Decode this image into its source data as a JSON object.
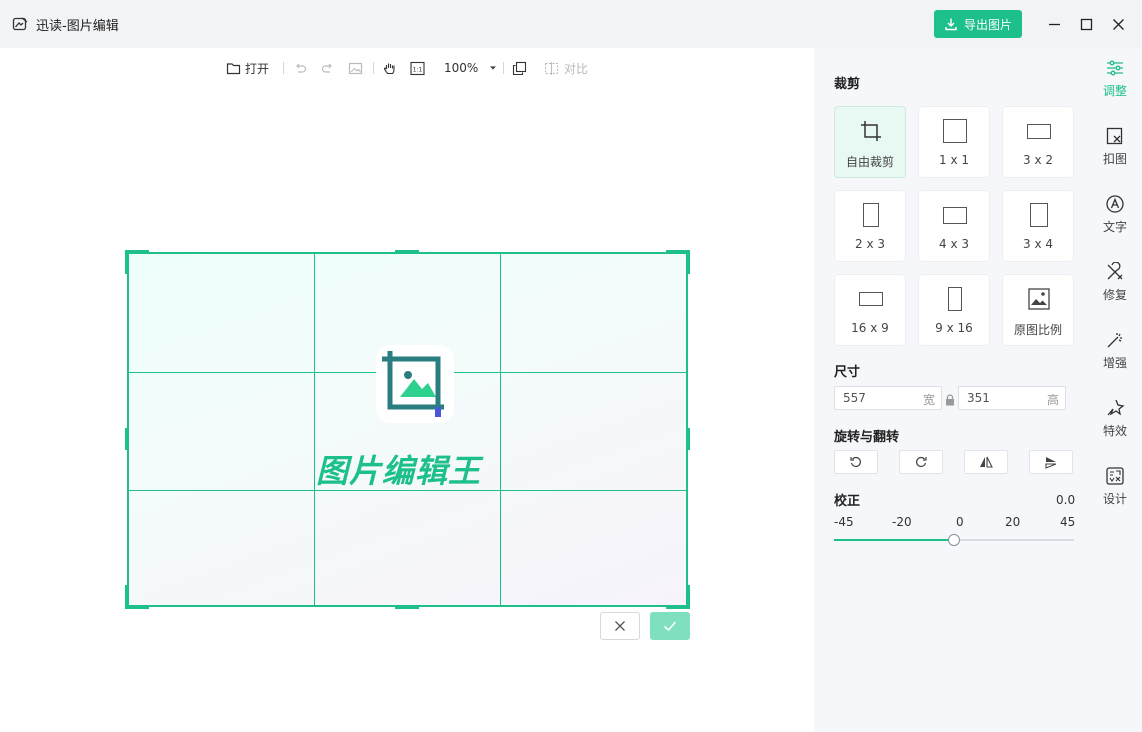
{
  "window": {
    "title": "迅读-图片编辑",
    "export_label": "导出图片"
  },
  "toolbar": {
    "open_label": "打开",
    "zoom": "100%",
    "compare_label": "对比",
    "actual_size_label": "1:1"
  },
  "canvas": {
    "logo_text": "图片编辑王"
  },
  "panel": {
    "crop_title": "裁剪",
    "crop_options": [
      {
        "label": "自由裁剪"
      },
      {
        "label": "1 x 1"
      },
      {
        "label": "3 x 2"
      },
      {
        "label": "2 x 3"
      },
      {
        "label": "4 x 3"
      },
      {
        "label": "3 x 4"
      },
      {
        "label": "16 x 9"
      },
      {
        "label": "9 x 16"
      },
      {
        "label": "原图比例"
      }
    ],
    "size_title": "尺寸",
    "width": "557",
    "width_unit": "宽",
    "height": "351",
    "height_unit": "高",
    "rotate_title": "旋转与翻转",
    "correct_title": "校正",
    "correct_value": "0.0",
    "ticks": [
      "-45",
      "-20",
      "0",
      "20",
      "45"
    ],
    "correct_slider_fraction": 0.5
  },
  "sidenav": [
    {
      "label": "调整"
    },
    {
      "label": "扣图"
    },
    {
      "label": "文字"
    },
    {
      "label": "修复"
    },
    {
      "label": "增强"
    },
    {
      "label": "特效"
    },
    {
      "label": "设计"
    }
  ],
  "colors": {
    "accent": "#1dbf8a",
    "panel_bg": "#f5f7fa",
    "titlebar_bg": "#f2f3f5"
  }
}
